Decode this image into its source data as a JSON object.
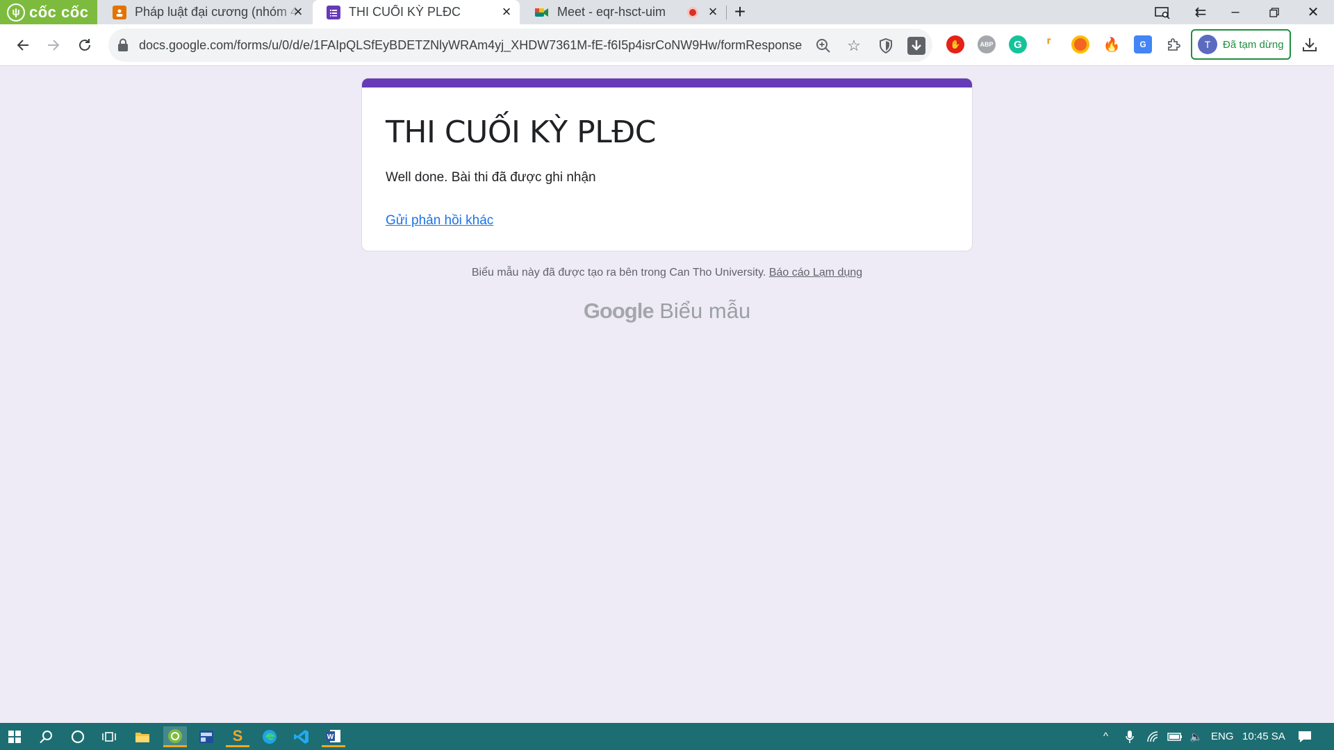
{
  "browser": {
    "logo_text": "cốc cốc",
    "tabs": [
      {
        "title": "Pháp luật đại cương (nhóm 4",
        "icon": "classroom-icon",
        "color": "#e37400"
      },
      {
        "title": "THI CUỐI KỲ PLĐC",
        "icon": "google-forms-icon",
        "color": "#673ab7"
      },
      {
        "title": "Meet - eqr-hsct-uim",
        "icon": "google-meet-icon",
        "color": "#00897b"
      }
    ],
    "url": "docs.google.com/forms/u/0/d/e/1FAIpQLSfEyBDETZNlyWRAm4yj_XHDW7361M-fE-f6I5p4isrCoNW9Hw/formResponse",
    "profile_label": "Đã tạm dừng",
    "profile_initial": "T"
  },
  "form": {
    "title": "THI CUỐI KỲ PLĐC",
    "confirmation": "Well done. Bài thi đã được ghi nhận",
    "another_response": "Gửi phản hồi khác",
    "footer_text": "Biểu mẫu này đã được tạo ra bên trong Can Tho University.",
    "report_abuse": "Báo cáo Lạm dụng",
    "brand_google": "Google",
    "brand_forms": "Biểu mẫu",
    "accent_color": "#673ab7"
  },
  "taskbar": {
    "language": "ENG",
    "time": "10:45 SA"
  }
}
